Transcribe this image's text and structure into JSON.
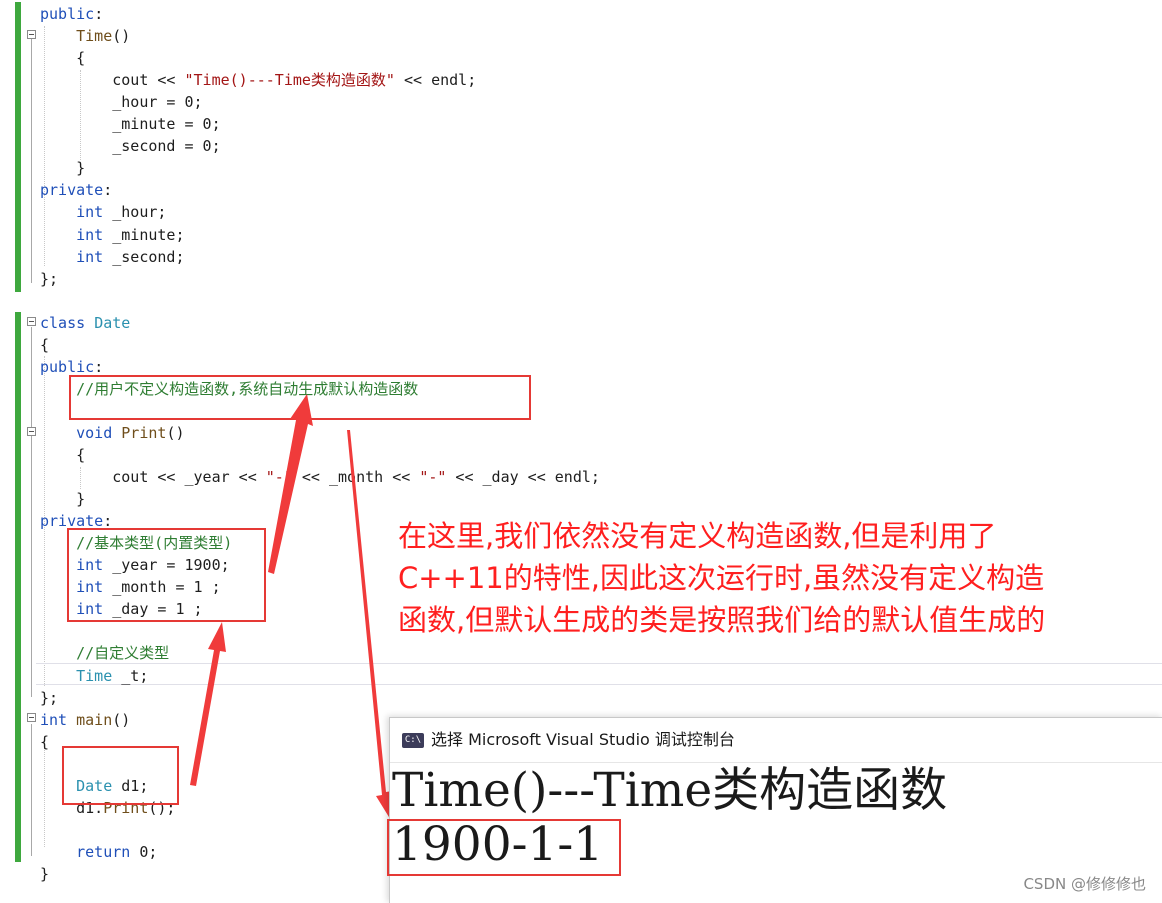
{
  "code_lines": [
    [
      {
        "t": "public",
        "c": "kw"
      },
      {
        "t": ":",
        "c": "pl"
      }
    ],
    [
      {
        "t": "    ",
        "c": "pl"
      },
      {
        "t": "Time",
        "c": "fn"
      },
      {
        "t": "()",
        "c": "pl"
      }
    ],
    [
      {
        "t": "    {",
        "c": "pl"
      }
    ],
    [
      {
        "t": "        cout << ",
        "c": "pl"
      },
      {
        "t": "\"Time()---Time类构造函数\"",
        "c": "st"
      },
      {
        "t": " << endl;",
        "c": "pl"
      }
    ],
    [
      {
        "t": "        _hour = 0;",
        "c": "pl"
      }
    ],
    [
      {
        "t": "        _minute = 0;",
        "c": "pl"
      }
    ],
    [
      {
        "t": "        _second = 0;",
        "c": "pl"
      }
    ],
    [
      {
        "t": "    }",
        "c": "pl"
      }
    ],
    [
      {
        "t": "private",
        "c": "kw"
      },
      {
        "t": ":",
        "c": "pl"
      }
    ],
    [
      {
        "t": "    ",
        "c": "pl"
      },
      {
        "t": "int",
        "c": "kw"
      },
      {
        "t": " _hour;",
        "c": "pl"
      }
    ],
    [
      {
        "t": "    ",
        "c": "pl"
      },
      {
        "t": "int",
        "c": "kw"
      },
      {
        "t": " _minute;",
        "c": "pl"
      }
    ],
    [
      {
        "t": "    ",
        "c": "pl"
      },
      {
        "t": "int",
        "c": "kw"
      },
      {
        "t": " _second;",
        "c": "pl"
      }
    ],
    [
      {
        "t": "};",
        "c": "pl"
      }
    ],
    [],
    [
      {
        "t": "class",
        "c": "kw"
      },
      {
        "t": " ",
        "c": "pl"
      },
      {
        "t": "Date",
        "c": "ty"
      }
    ],
    [
      {
        "t": "{",
        "c": "pl"
      }
    ],
    [
      {
        "t": "public",
        "c": "kw"
      },
      {
        "t": ":",
        "c": "pl"
      }
    ],
    [
      {
        "t": "    //用户不定义构造函数,系统自动生成默认构造函数",
        "c": "cm"
      }
    ],
    [],
    [
      {
        "t": "    ",
        "c": "pl"
      },
      {
        "t": "void",
        "c": "kw"
      },
      {
        "t": " ",
        "c": "pl"
      },
      {
        "t": "Print",
        "c": "fn"
      },
      {
        "t": "()",
        "c": "pl"
      }
    ],
    [
      {
        "t": "    {",
        "c": "pl"
      }
    ],
    [
      {
        "t": "        cout << _year << ",
        "c": "pl"
      },
      {
        "t": "\"-\"",
        "c": "st"
      },
      {
        "t": " << _month << ",
        "c": "pl"
      },
      {
        "t": "\"-\"",
        "c": "st"
      },
      {
        "t": " << _day << endl;",
        "c": "pl"
      }
    ],
    [
      {
        "t": "    }",
        "c": "pl"
      }
    ],
    [
      {
        "t": "private",
        "c": "kw"
      },
      {
        "t": ":",
        "c": "pl"
      }
    ],
    [
      {
        "t": "    //基本类型(内置类型)",
        "c": "cm"
      }
    ],
    [
      {
        "t": "    ",
        "c": "pl"
      },
      {
        "t": "int",
        "c": "kw"
      },
      {
        "t": " _year = 1900;",
        "c": "pl"
      }
    ],
    [
      {
        "t": "    ",
        "c": "pl"
      },
      {
        "t": "int",
        "c": "kw"
      },
      {
        "t": " _month = 1 ;",
        "c": "pl"
      }
    ],
    [
      {
        "t": "    ",
        "c": "pl"
      },
      {
        "t": "int",
        "c": "kw"
      },
      {
        "t": " _day = 1 ;",
        "c": "pl"
      }
    ],
    [],
    [
      {
        "t": "    //自定义类型",
        "c": "cm"
      }
    ],
    [
      {
        "t": "    ",
        "c": "pl"
      },
      {
        "t": "Time",
        "c": "ty"
      },
      {
        "t": " _t;",
        "c": "pl"
      }
    ],
    [
      {
        "t": "};",
        "c": "pl"
      }
    ],
    [
      {
        "t": "int",
        "c": "kw"
      },
      {
        "t": " ",
        "c": "pl"
      },
      {
        "t": "main",
        "c": "fn"
      },
      {
        "t": "()",
        "c": "pl"
      }
    ],
    [
      {
        "t": "{",
        "c": "pl"
      }
    ],
    [],
    [
      {
        "t": "    ",
        "c": "pl"
      },
      {
        "t": "Date",
        "c": "ty"
      },
      {
        "t": " d1;",
        "c": "pl"
      }
    ],
    [
      {
        "t": "    d1.",
        "c": "pl"
      },
      {
        "t": "Print",
        "c": "fn"
      },
      {
        "t": "();",
        "c": "pl"
      }
    ],
    [],
    [
      {
        "t": "    ",
        "c": "pl"
      },
      {
        "t": "return",
        "c": "kw"
      },
      {
        "t": " 0;",
        "c": "pl"
      }
    ],
    [
      {
        "t": "}",
        "c": "pl"
      }
    ]
  ],
  "annotation": {
    "line1": "在这里,我们依然没有定义构造函数,但是利用了",
    "line2": "C++11的特性,因此这次运行时,虽然没有定义构造",
    "line3": "函数,但默认生成的类是按照我们给的默认值生成的"
  },
  "console": {
    "icon_text": "C:\\",
    "title": "选择 Microsoft Visual Studio 调试控制台",
    "output_line1": "Time()---Time类构造函数",
    "output_line2": "1900-1-1"
  },
  "watermark": "CSDN @修修修也",
  "colors": {
    "annotation_red": "#ff1f1f",
    "box_red": "#e53935",
    "gutter_green": "#3ea83e",
    "keyword_blue": "#1f4fb8",
    "type_teal": "#2b91af",
    "comment_green": "#2e7d32",
    "string_red": "#a31515"
  }
}
